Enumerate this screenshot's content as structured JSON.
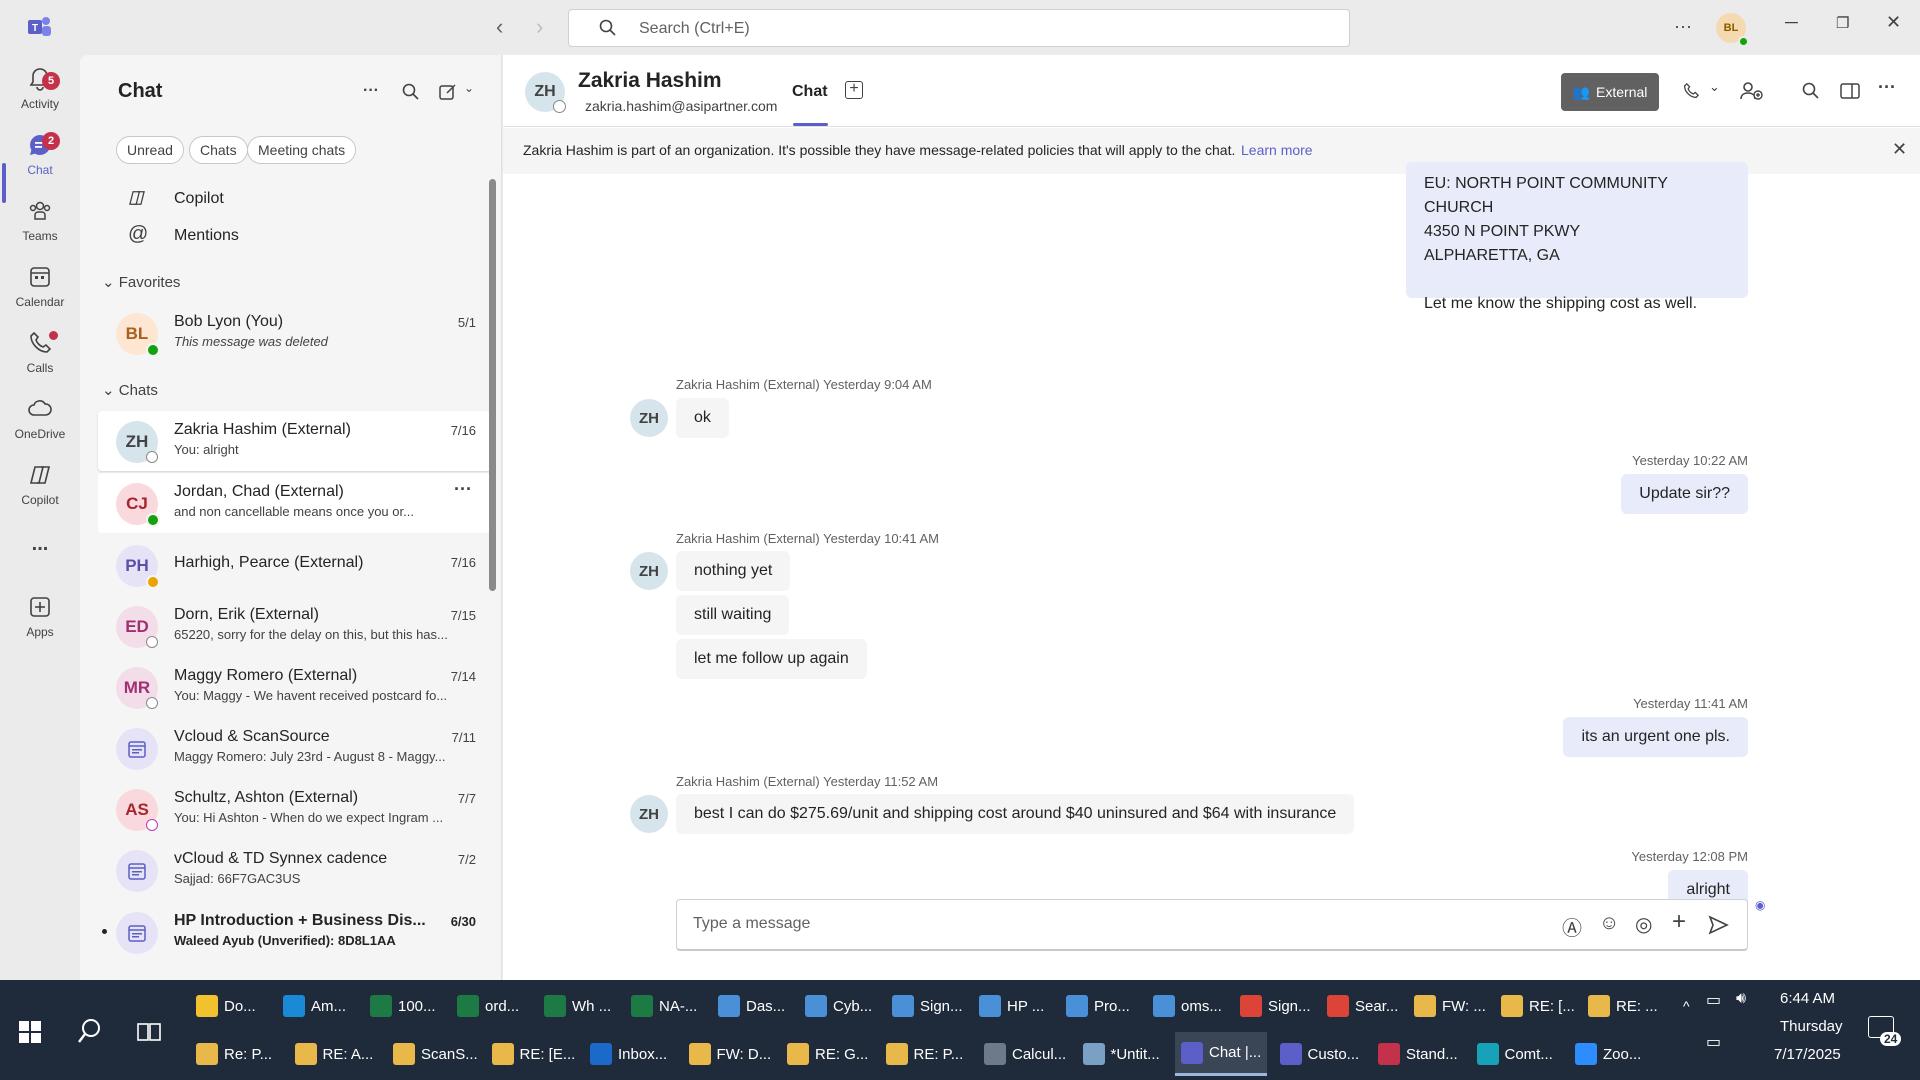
{
  "titlebar": {
    "search_placeholder": "Search (Ctrl+E)",
    "me_initials": "BL"
  },
  "rail": {
    "items": [
      {
        "label": "Activity",
        "badge": "5"
      },
      {
        "label": "Chat",
        "badge": "2"
      },
      {
        "label": "Teams"
      },
      {
        "label": "Calendar"
      },
      {
        "label": "Calls"
      },
      {
        "label": "OneDrive"
      },
      {
        "label": "Copilot"
      },
      {
        "label": "..."
      },
      {
        "label": "Apps"
      }
    ]
  },
  "chatlist": {
    "title": "Chat",
    "filters": [
      "Unread",
      "Chats",
      "Meeting chats"
    ],
    "pinned": [
      "Copilot",
      "Mentions"
    ],
    "favorites_label": "Favorites",
    "chats_label": "Chats",
    "favorites": [
      {
        "initials": "BL",
        "name": "Bob Lyon (You)",
        "sub": "This message was deleted",
        "date": "5/1"
      }
    ],
    "chats": [
      {
        "initials": "ZH",
        "name": "Zakria Hashim  (External)",
        "sub": "You: alright",
        "date": "7/16"
      },
      {
        "initials": "CJ",
        "name": "Jordan, Chad  (External)",
        "sub": "and non cancellable means once you or...",
        "date": ""
      },
      {
        "initials": "PH",
        "name": "Harhigh, Pearce  (External)",
        "sub": "",
        "date": "7/16"
      },
      {
        "initials": "ED",
        "name": "Dorn, Erik  (External)",
        "sub": "65220, sorry for the delay on this, but this has...",
        "date": "7/15"
      },
      {
        "initials": "MR",
        "name": "Maggy Romero  (External)",
        "sub": "You: Maggy - We havent received postcard fo...",
        "date": "7/14"
      },
      {
        "initials": "",
        "name": "Vcloud & ScanSource",
        "sub": "Maggy Romero: July 23rd - August 8 - Maggy...",
        "date": "7/11"
      },
      {
        "initials": "AS",
        "name": "Schultz, Ashton  (External)",
        "sub": "You: Hi Ashton -  When do we expect Ingram ...",
        "date": "7/7"
      },
      {
        "initials": "",
        "name": "vCloud & TD Synnex cadence",
        "sub": "Sajjad: 66F7GAC3US",
        "date": "7/2"
      },
      {
        "initials": "",
        "name": "HP Introduction + Business Dis...",
        "sub": "Waleed Ayub (Unverified): 8D8L1AA",
        "date": "6/30"
      }
    ]
  },
  "chat": {
    "initials": "ZH",
    "name": "Zakria Hashim",
    "email": "zakria.hashim@asipartner.com",
    "tab": "Chat",
    "external_label": "External",
    "banner_text": "Zakria Hashim is part of an organization. It's possible they have message-related policies that will apply to the chat.",
    "banner_link": "Learn more",
    "composer_placeholder": "Type a message",
    "top_card": [
      "EU: NORTH POINT COMMUNITY CHURCH",
      "4350 N POINT PKWY",
      "ALPHARETTA, GA",
      "",
      "Let me know the shipping cost as well."
    ],
    "messages": [
      {
        "meta": "Zakria Hashim (External)   Yesterday 9:04 AM",
        "lines": [
          "ok"
        ]
      },
      {
        "meta": "Yesterday 10:22 AM",
        "lines": [
          "Update sir??"
        ]
      },
      {
        "meta": "Zakria Hashim (External)   Yesterday 10:41 AM",
        "lines": [
          "nothing yet",
          "still waiting",
          "let me follow up again"
        ]
      },
      {
        "meta": "Yesterday 11:41 AM",
        "lines": [
          "its an urgent one pls."
        ]
      },
      {
        "meta": "Zakria Hashim (External)   Yesterday 11:52 AM",
        "lines": [
          "best I can do $275.69/unit and shipping cost around $40 uninsured and $64 with insurance"
        ]
      },
      {
        "meta": "Yesterday 12:08 PM",
        "lines": [
          "alright"
        ]
      }
    ]
  },
  "taskbar": {
    "row1": [
      "Do...",
      "Am...",
      "100...",
      "ord...",
      "Wh ...",
      "NA-...",
      "Das...",
      "Cyb...",
      "Sign...",
      "HP ...",
      "Pro...",
      "oms...",
      "Sign...",
      "Sear...",
      "FW: ...",
      "RE: [...",
      "RE: ..."
    ],
    "row2": [
      "Re: P...",
      "RE: A...",
      "ScanS...",
      "RE: [E...",
      "Inbox...",
      "FW: D...",
      "RE: G...",
      "RE: P...",
      "Calcul...",
      "*Untit...",
      "Chat |...",
      "Custo...",
      "Stand...",
      "Comt...",
      "Zoo..."
    ],
    "time": "6:44 AM",
    "day": "Thursday",
    "date": "7/17/2025",
    "notif_count": "24"
  }
}
